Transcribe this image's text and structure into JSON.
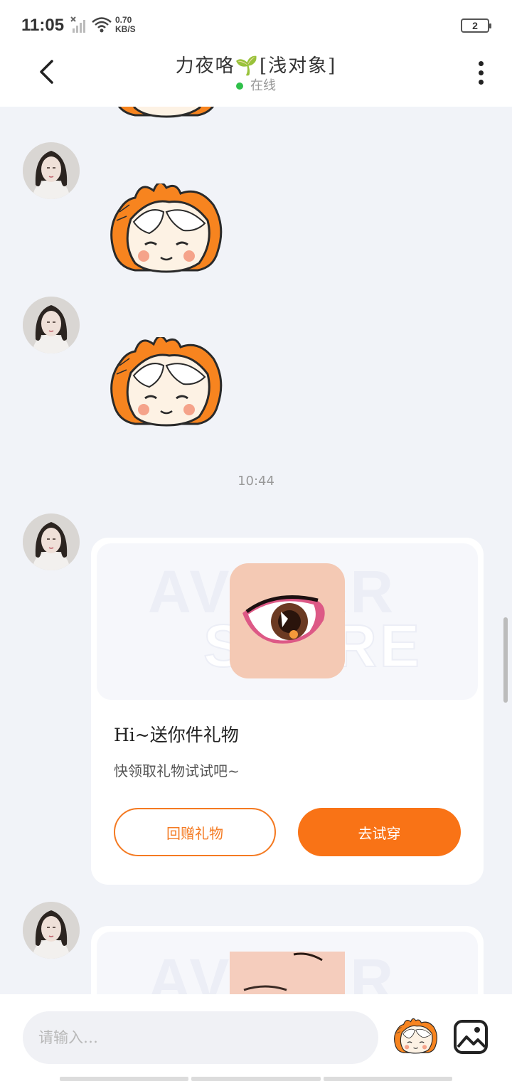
{
  "status_bar": {
    "time": "11:05",
    "net_speed_value": "0.70",
    "net_speed_unit": "KB/S",
    "battery": "2",
    "icons": [
      "signal-icon",
      "wifi-icon",
      "battery-icon"
    ]
  },
  "header": {
    "title": "力夜咯🌱[浅对象]",
    "status": "在线",
    "back_icon": "chevron-left-icon",
    "more_icon": "more-vertical-icon"
  },
  "chat": {
    "timestamp": "10:44",
    "gift_card": {
      "title": "Hi~送你件礼物",
      "subtitle": "快领取礼物试试吧~",
      "watermark_line1": "AVATAR",
      "watermark_line2": "STORE",
      "return_gift_label": "回赠礼物",
      "try_on_label": "去试穿"
    }
  },
  "input_bar": {
    "placeholder": "请输入…",
    "emoji_icon": "emoji-sticker-icon",
    "image_icon": "image-icon"
  },
  "colors": {
    "accent": "#f97316",
    "online": "#2fc04a",
    "background": "#f1f3f8"
  }
}
